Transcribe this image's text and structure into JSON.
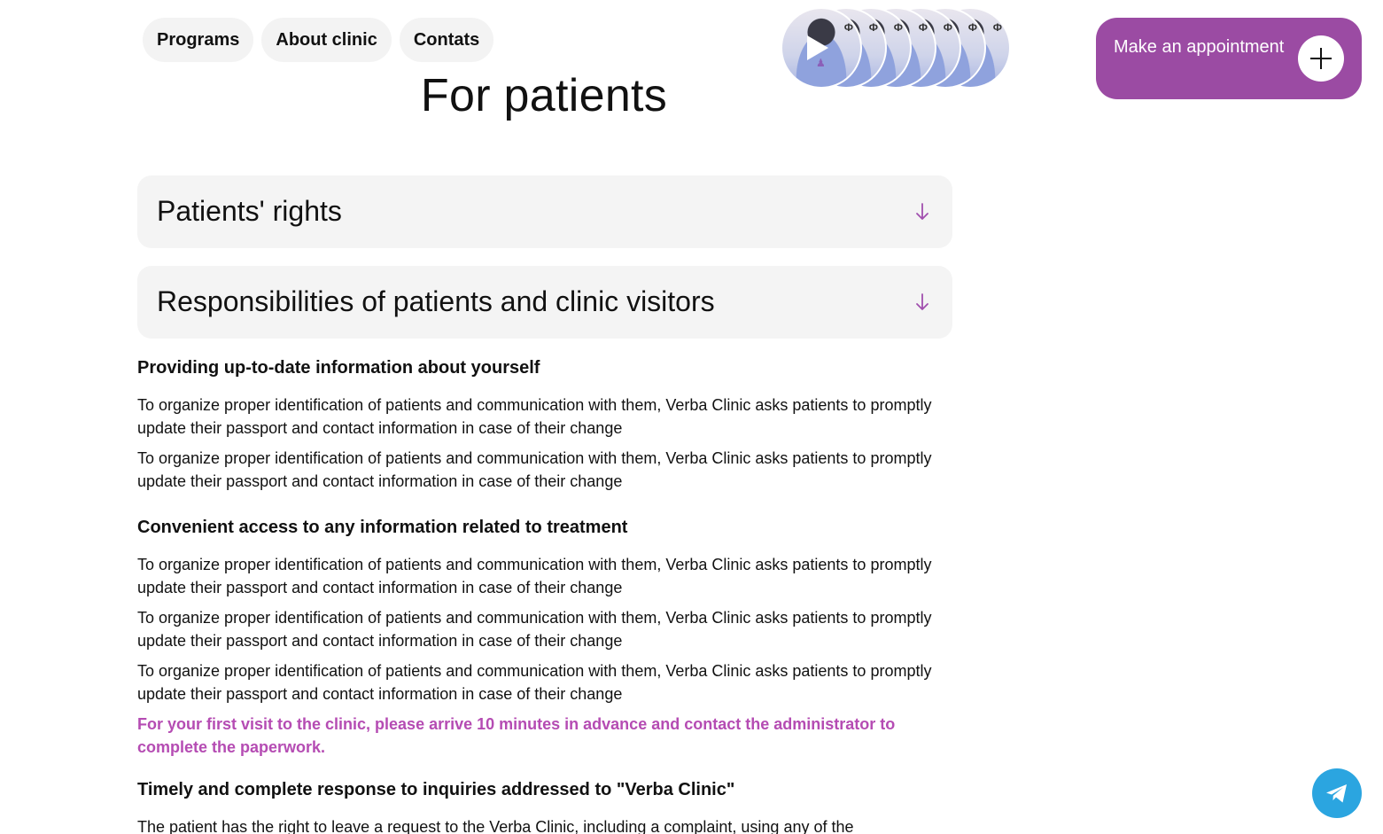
{
  "nav": {
    "items": [
      {
        "label": "Programs"
      },
      {
        "label": "About clinic"
      },
      {
        "label": "Contats"
      }
    ]
  },
  "page": {
    "title": "For patients"
  },
  "video_stories": {
    "logo_text": "Ф",
    "count": 7
  },
  "cta": {
    "label": "Make an appointment",
    "color": "#9b4ba3"
  },
  "accordion": [
    {
      "label": "Patients' rights"
    },
    {
      "label": "Responsibilities of patients and clinic visitors"
    }
  ],
  "sections": [
    {
      "heading": "Providing up-to-date information about yourself",
      "paragraphs": [
        "To organize proper identification of patients and communication with them, Verba Clinic asks patients to promptly update their passport and contact information in case of their change",
        "To organize proper identification of patients and communication with them, Verba Clinic asks patients to promptly update their passport and contact information in case of their change"
      ]
    },
    {
      "heading": "Convenient access to any information related to treatment",
      "paragraphs": [
        "To organize proper identification of patients and communication with them, Verba Clinic asks patients to promptly update their passport and contact information in case of their change",
        "To organize proper identification of patients and communication with them, Verba Clinic asks patients to promptly update their passport and contact information in case of their change",
        "To organize proper identification of patients and communication with them, Verba Clinic asks patients to promptly update their passport and contact information in case of their change"
      ],
      "highlight": "For your first visit to the clinic, please arrive 10 minutes in advance and contact the administrator to complete the paperwork."
    },
    {
      "heading": "Timely and complete response to inquiries addressed to \"Verba Clinic\"",
      "paragraphs": [
        "The patient has the right to leave a request to the Verba Clinic, including a complaint, using any of the"
      ]
    }
  ],
  "colors": {
    "accent": "#9b4ba3",
    "highlight_text": "#b54cb3",
    "telegram": "#2ba5e0",
    "panel": "#f4f4f4"
  },
  "icons": {
    "cta": "plus-icon",
    "accordion": "arrow-down-icon",
    "floating": "telegram-icon",
    "video": "play-icon"
  }
}
